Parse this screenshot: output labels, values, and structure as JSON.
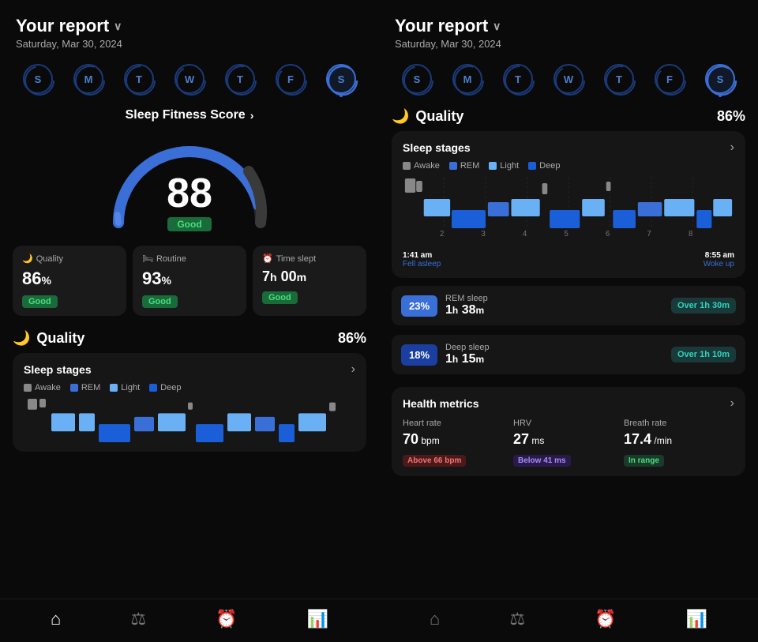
{
  "left": {
    "header": {
      "title": "Your report",
      "chevron": "∨",
      "date": "Saturday, Mar 30, 2024"
    },
    "days": [
      {
        "label": "S",
        "active": false
      },
      {
        "label": "M",
        "active": false
      },
      {
        "label": "T",
        "active": false
      },
      {
        "label": "W",
        "active": false
      },
      {
        "label": "T",
        "active": false
      },
      {
        "label": "F",
        "active": false
      },
      {
        "label": "S",
        "active": true
      }
    ],
    "fitness": {
      "label": "Sleep Fitness Score",
      "score": "88",
      "badge": "Good"
    },
    "metrics": [
      {
        "icon": "🌙",
        "title": "Quality",
        "value": "86",
        "unit": "%",
        "badge": "Good"
      },
      {
        "icon": "🛏",
        "title": "Routine",
        "value": "93",
        "unit": "%",
        "badge": "Good"
      },
      {
        "icon": "⏰",
        "title": "Time slept",
        "value": "7h 00m",
        "unit": "",
        "badge": "Good"
      }
    ],
    "quality": {
      "title": "Quality",
      "percentage": "86%",
      "stages": {
        "title": "Sleep stages",
        "legend": [
          {
            "color": "#888",
            "label": "Awake"
          },
          {
            "color": "#3a6fd8",
            "label": "REM"
          },
          {
            "color": "#6ab0f5",
            "label": "Light"
          },
          {
            "color": "#1a3fa0",
            "label": "Deep"
          }
        ]
      }
    }
  },
  "right": {
    "header": {
      "title": "Your report",
      "chevron": "∨",
      "date": "Saturday, Mar 30, 2024"
    },
    "days": [
      {
        "label": "S",
        "active": false
      },
      {
        "label": "M",
        "active": false
      },
      {
        "label": "T",
        "active": false
      },
      {
        "label": "W",
        "active": false
      },
      {
        "label": "T",
        "active": false
      },
      {
        "label": "F",
        "active": false
      },
      {
        "label": "S",
        "active": true
      }
    ],
    "quality": {
      "title": "Quality",
      "percentage": "86%",
      "stages": {
        "title": "Sleep stages",
        "legend": [
          {
            "color": "#888",
            "label": "Awake"
          },
          {
            "color": "#3a6fd8",
            "label": "REM"
          },
          {
            "color": "#6ab0f5",
            "label": "Light"
          },
          {
            "color": "#1a3fa0",
            "label": "Deep"
          }
        ],
        "timeStart": "1:41 am",
        "timeStartLabel": "Fell asleep",
        "timeEnd": "8:55 am",
        "timeEndLabel": "Woke up"
      },
      "rem": {
        "pct": "23%",
        "type": "REM sleep",
        "duration": "1h 38m",
        "badge": "Over 1h 30m"
      },
      "deep": {
        "pct": "18%",
        "type": "Deep sleep",
        "duration": "1h 15m",
        "badge": "Over 1h 10m"
      }
    },
    "health": {
      "title": "Health metrics",
      "metrics": [
        {
          "label": "Heart rate",
          "value": "70",
          "unit": "bpm",
          "badge": "Above 66 bpm",
          "badgeType": "red"
        },
        {
          "label": "HRV",
          "value": "27",
          "unit": "ms",
          "badge": "Below 41 ms",
          "badgeType": "purple"
        },
        {
          "label": "Breath rate",
          "value": "17.4",
          "unit": "/min",
          "badge": "In range",
          "badgeType": "green"
        }
      ]
    }
  },
  "nav": {
    "items": [
      "⌂",
      "⚖",
      "⏰",
      "📊"
    ]
  }
}
